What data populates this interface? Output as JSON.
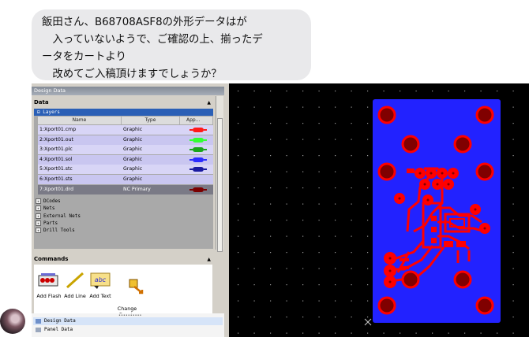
{
  "message": {
    "text": "飯田さん、B68708ASF8の外形データはが\n　入っていないようで、ご確認の上、揃ったデ\nータをカートより\n　改めてご入稿頂けますでしょうか？"
  },
  "app": {
    "panel_title": "Design Data",
    "data_section": {
      "title": "Data"
    },
    "layers": {
      "title": "Layers",
      "columns": [
        "Name",
        "Type",
        "App..."
      ],
      "rows": [
        {
          "name": "1:Xport01.cmp",
          "type": "Graphic",
          "color": "#ff1a1a"
        },
        {
          "name": "2:Xport01.out",
          "type": "Graphic",
          "color": "#33ff33"
        },
        {
          "name": "3:Xport01.plc",
          "type": "Graphic",
          "color": "#1aa61a"
        },
        {
          "name": "4:Xport01.sol",
          "type": "Graphic",
          "color": "#2b2bff"
        },
        {
          "name": "5:Xport01.stc",
          "type": "Graphic",
          "color": "#1a1aa0"
        },
        {
          "name": "6:Xport01.sts",
          "type": "Graphic",
          "color": ""
        },
        {
          "name": "7:Xport01.drd",
          "type": "NC Primary",
          "color": "#7a0000"
        }
      ]
    },
    "tree_nodes": [
      "DCodes",
      "Nets",
      "External Nets",
      "Parts",
      "Drill Tools"
    ],
    "commands": {
      "title": "Commands",
      "tools": [
        {
          "label": "Add Flash",
          "icon": "add-flash-icon"
        },
        {
          "label": "Add Line",
          "icon": "add-line-icon"
        },
        {
          "label": "Add Text",
          "icon": "add-text-icon"
        },
        {
          "label": "Change\nDcode",
          "icon": "change-dcode-icon"
        }
      ]
    },
    "tabs": [
      "Design Data",
      "Panel Data"
    ]
  },
  "colors": {
    "board": "#2222ff",
    "copper": "#ff0000",
    "drill": "#800000",
    "background": "#000000",
    "selection": "#2a5fb6"
  }
}
